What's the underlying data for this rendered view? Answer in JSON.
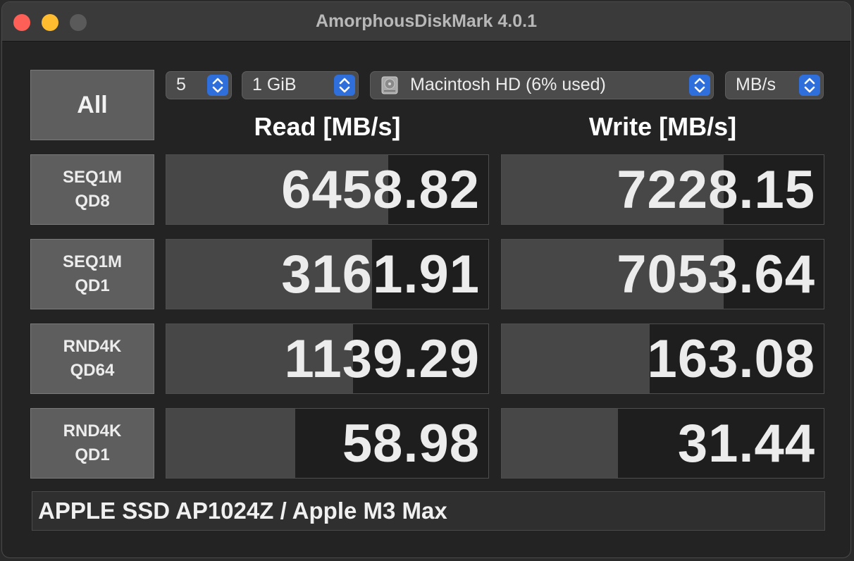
{
  "window": {
    "title": "AmorphousDiskMark 4.0.1"
  },
  "toolbar": {
    "all_button": "All",
    "count": "5",
    "size": "1 GiB",
    "drive": "Macintosh HD (6% used)",
    "unit": "MB/s"
  },
  "headers": {
    "read": "Read [MB/s]",
    "write": "Write [MB/s]"
  },
  "rows": [
    {
      "line1": "SEQ1M",
      "line2": "QD8",
      "read": "6458.82",
      "write": "7228.15",
      "read_level": 0.69,
      "write_level": 0.69
    },
    {
      "line1": "SEQ1M",
      "line2": "QD1",
      "read": "3161.91",
      "write": "7053.64",
      "read_level": 0.64,
      "write_level": 0.69
    },
    {
      "line1": "RND4K",
      "line2": "QD64",
      "read": "1139.29",
      "write": "163.08",
      "read_level": 0.58,
      "write_level": 0.46
    },
    {
      "line1": "RND4K",
      "line2": "QD1",
      "read": "58.98",
      "write": "31.44",
      "read_level": 0.4,
      "write_level": 0.36
    }
  ],
  "footer": {
    "text": "APPLE SSD AP1024Z / Apple M3 Max"
  },
  "colors": {
    "accent": "#2f6fdb",
    "bar": "#474747",
    "cell_bg": "#1e1e1e",
    "close": "#fe5f57",
    "minimize": "#febc2e"
  },
  "icons": {
    "disk": "hard-drive-icon",
    "stepper": "chevron-up-down-icon"
  }
}
